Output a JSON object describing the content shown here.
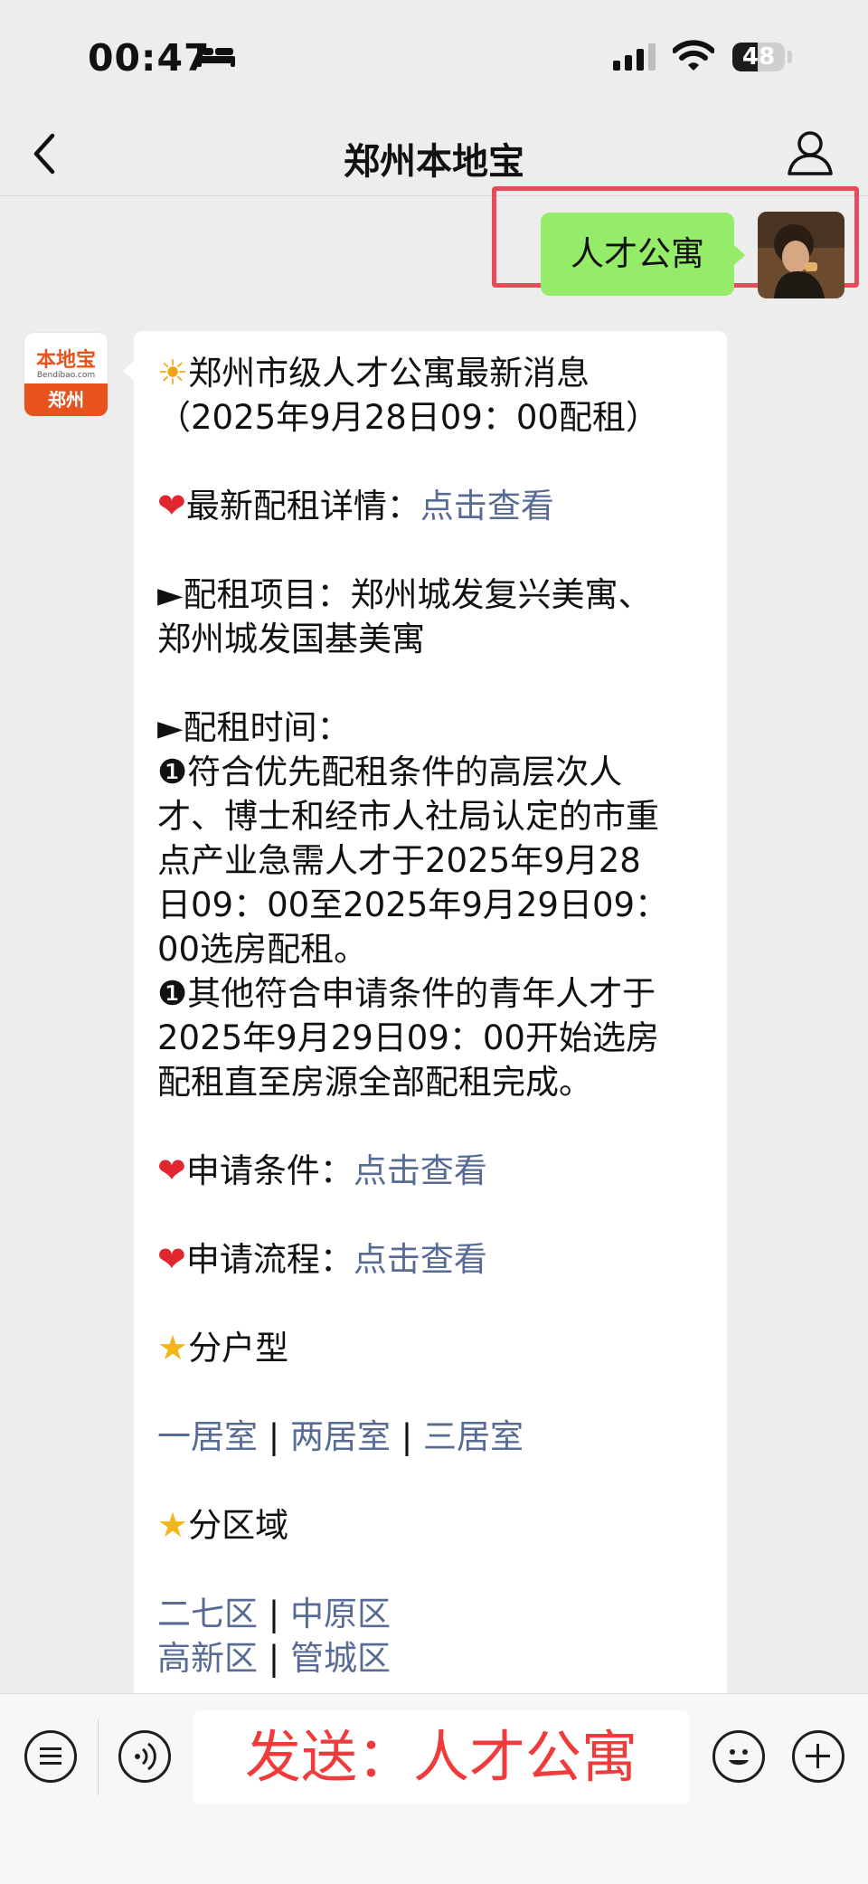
{
  "status_bar": {
    "time": "00:47",
    "battery": "48"
  },
  "nav": {
    "title": "郑州本地宝"
  },
  "sent_message": {
    "text": "人才公寓"
  },
  "bot": {
    "logo_top": "本地宝",
    "logo_site": "Bendibao.com",
    "logo_city": "郑州"
  },
  "message": {
    "headline": "郑州市级人才公寓最新消息",
    "headline_date": "（2025年9月28日09：00配租）",
    "details_label": "最新配租详情：",
    "details_link": "点击查看",
    "project_label": "►配租项目：郑州城发复兴美寓、",
    "project_label_2": "郑州城发国基美寓",
    "time_label": "►配租时间：",
    "time_line1": "❶符合优先配租条件的高层次人",
    "time_line2": "才、博士和经市人社局认定的市重",
    "time_line3": "点产业急需人才于2025年9月28",
    "time_line4": "日09：00至2025年9月29日09：",
    "time_line5": "00选房配租。",
    "time_line6": "❶其他符合申请条件的青年人才于",
    "time_line7": "2025年9月29日09：00开始选房",
    "time_line8": "配租直至房源全部配租完成。",
    "conditions_label": "申请条件：",
    "conditions_link": "点击查看",
    "process_label": "申请流程：",
    "process_link": "点击查看",
    "unit_type_label": "分户型",
    "unit_types": [
      "一居室",
      "两居室",
      "三居室"
    ],
    "district_label": "分区域",
    "districts_row1": [
      "二七区",
      "中原区"
    ],
    "districts_row2": [
      "高新区",
      "管城区"
    ],
    "separator": " | "
  },
  "input_bar": {
    "text": "发送：人才公寓"
  }
}
